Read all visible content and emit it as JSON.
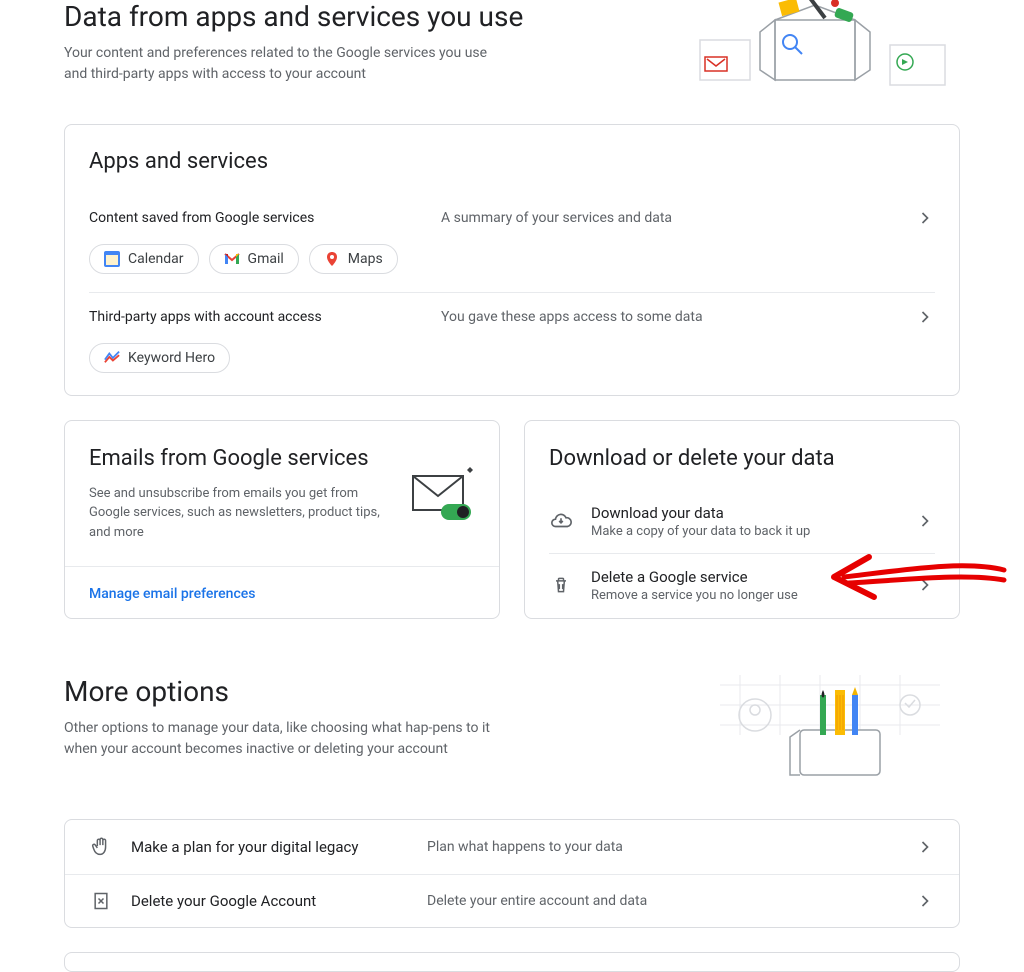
{
  "dataApps": {
    "title": "Data from apps and services you use",
    "desc": "Your content and preferences related to the Google services you use and third-party apps with access to your account"
  },
  "appsCard": {
    "title": "Apps and services",
    "row1": {
      "label": "Content saved from Google services",
      "sub": "A summary of your services and data"
    },
    "chips": {
      "calendar": "Calendar",
      "gmail": "Gmail",
      "maps": "Maps"
    },
    "row2": {
      "label": "Third-party apps with account access",
      "sub": "You gave these apps access to some data"
    },
    "chip2": {
      "keyword": "Keyword Hero"
    }
  },
  "emailsCard": {
    "title": "Emails from Google services",
    "desc": "See and unsubscribe from emails you get from Google services, such as newsletters, product tips, and more",
    "link": "Manage email preferences"
  },
  "downloadCard": {
    "title": "Download or delete your data",
    "item1": {
      "title": "Download your data",
      "sub": "Make a copy of your data to back it up"
    },
    "item2": {
      "title": "Delete a Google service",
      "sub": "Remove a service you no longer use"
    }
  },
  "moreOptions": {
    "title": "More options",
    "desc": "Other options to manage your data, like choosing what hap-pens to it when your account becomes inactive or deleting your account",
    "row1": {
      "label": "Make a plan for your digital legacy",
      "sub": "Plan what happens to your data"
    },
    "row2": {
      "label": "Delete your Google Account",
      "sub": "Delete your entire account and data"
    }
  }
}
